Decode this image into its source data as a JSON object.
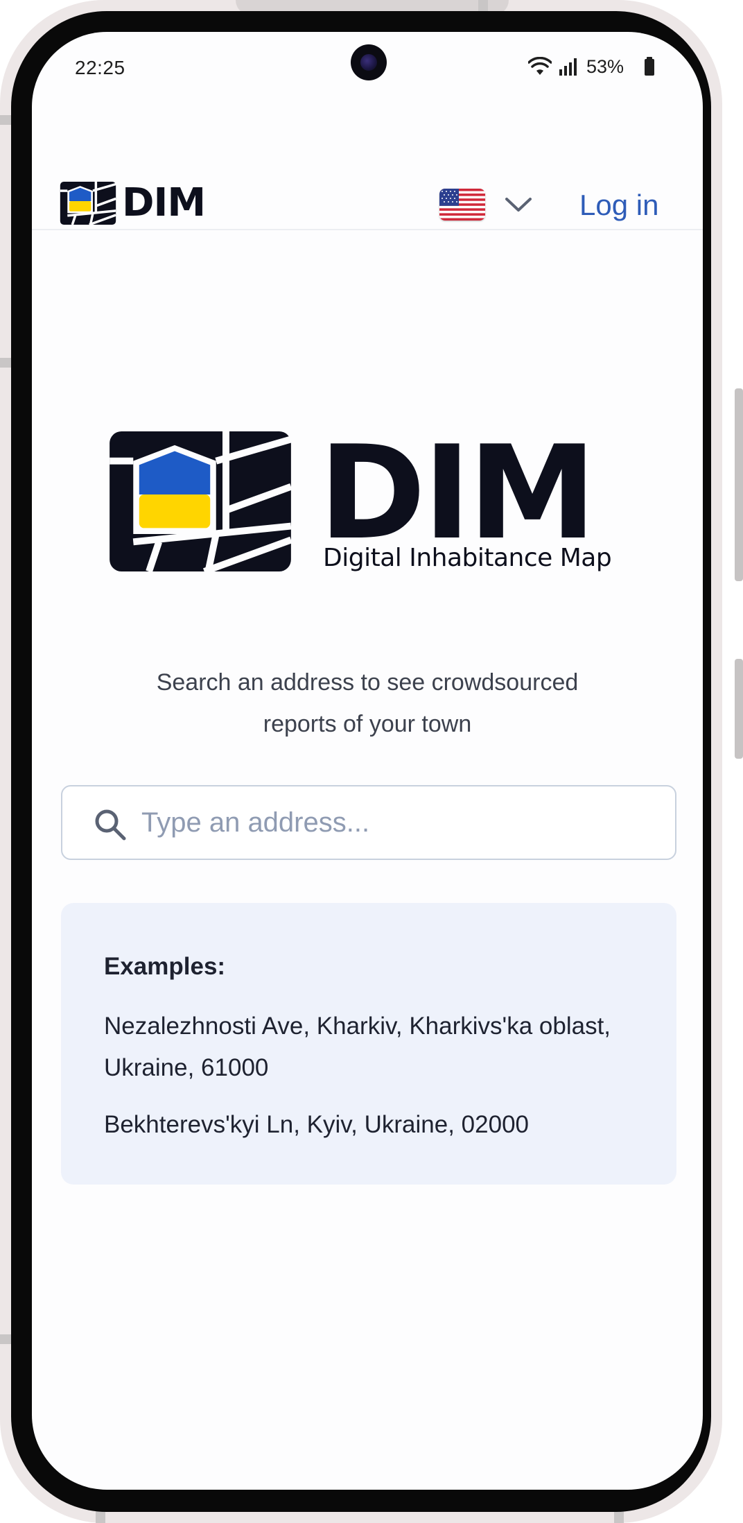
{
  "status_bar": {
    "time": "22:25",
    "battery_percent": "53%",
    "icons": [
      "wifi-icon",
      "signal-icon",
      "battery-icon"
    ]
  },
  "header": {
    "brand": "DIM",
    "language_flag": "us-flag-icon",
    "login_label": "Log in"
  },
  "hero": {
    "wordmark": "DIM",
    "subtitle": "Digital Inhabitance Map",
    "tagline": "Search an address to see crowdsourced reports of your town"
  },
  "search": {
    "placeholder": "Type an address...",
    "value": ""
  },
  "examples": {
    "title": "Examples:",
    "items": [
      "Nezalezhnosti Ave, Kharkiv, Kharkivs'ka oblast, Ukraine, 61000",
      "Bekhterevs'kyi Ln, Kyiv, Ukraine, 02000"
    ]
  },
  "colors": {
    "brand_dark": "#0d0f1c",
    "ukraine_blue": "#1e5bc6",
    "ukraine_yellow": "#ffd500",
    "link_blue": "#2e5cb8",
    "examples_bg": "#eef2fb"
  }
}
